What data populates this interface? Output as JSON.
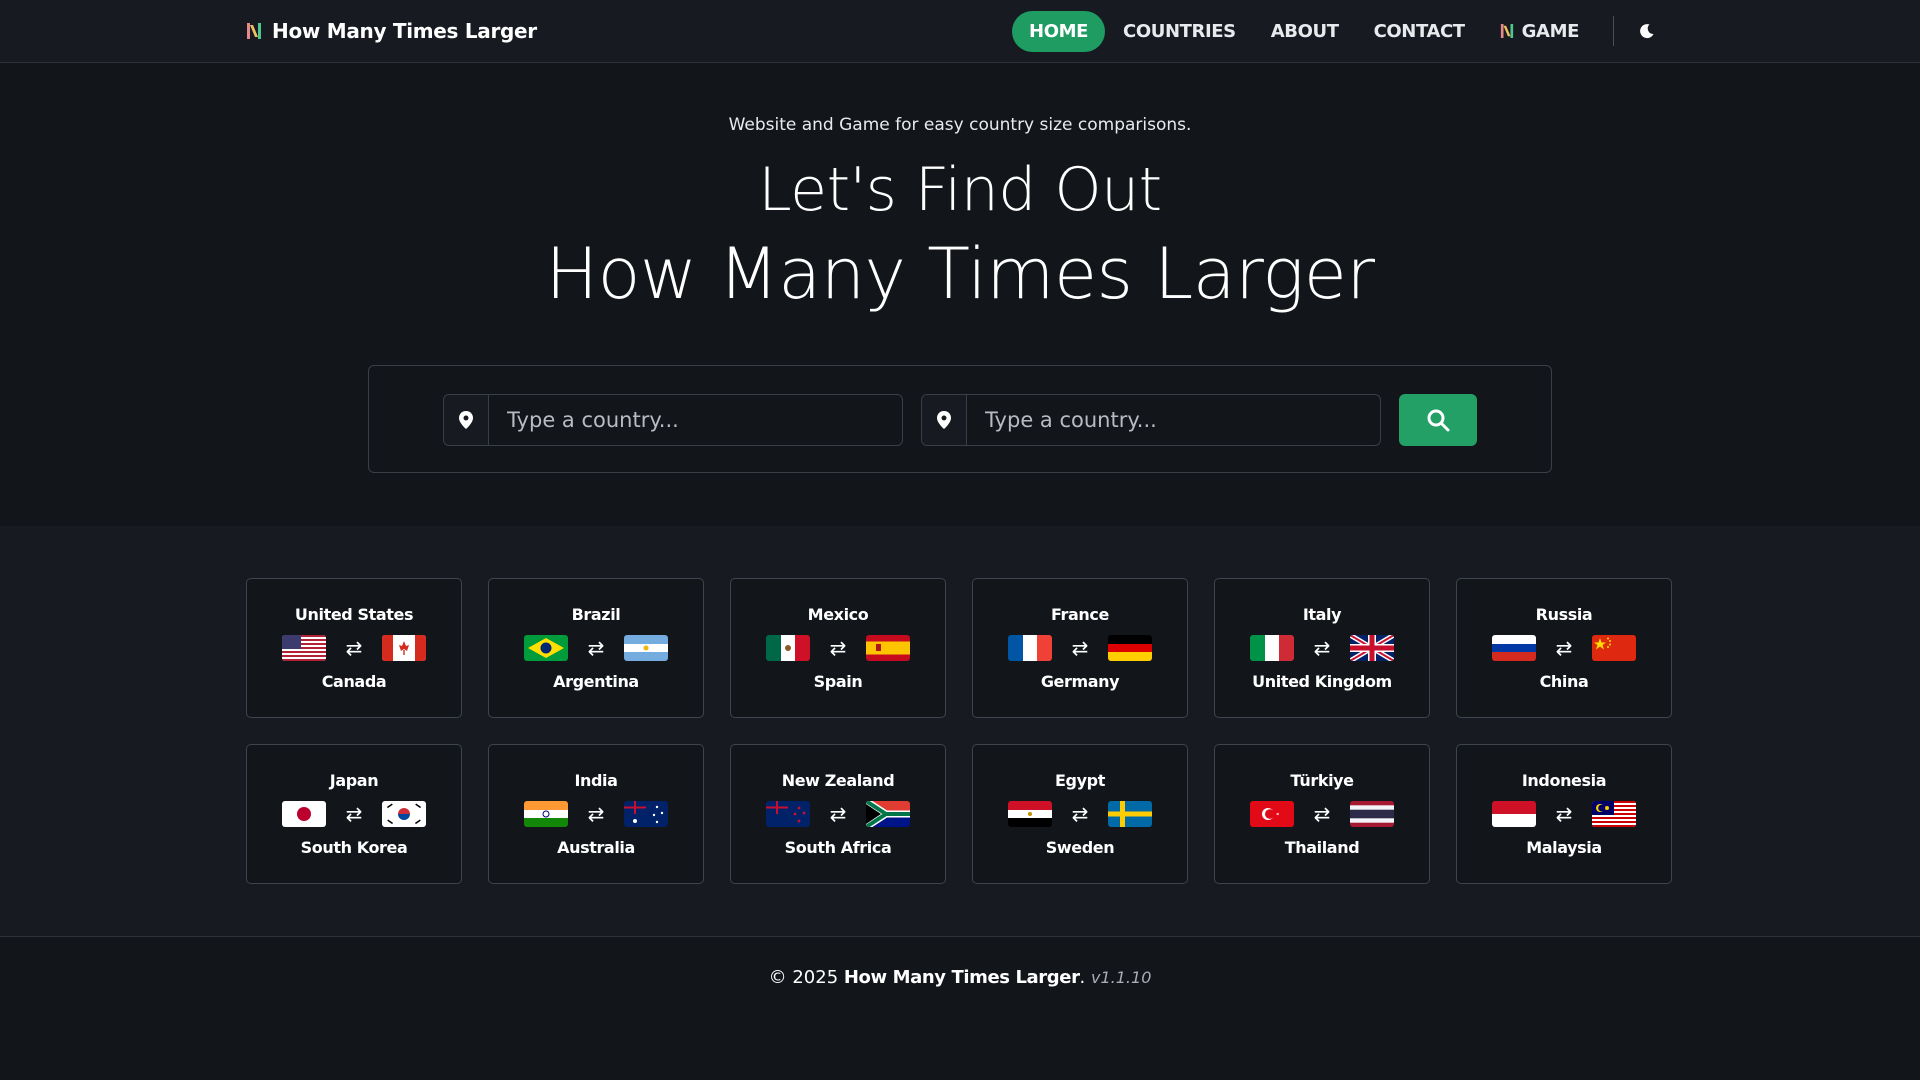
{
  "nav": {
    "brand": "How Many Times Larger",
    "items": {
      "home": "HOME",
      "countries": "COUNTRIES",
      "about": "ABOUT",
      "contact": "CONTACT",
      "game": "GAME"
    },
    "theme_icon": "moon-icon"
  },
  "hero": {
    "tagline": "Website and Game for easy country size comparisons.",
    "line1": "Let's Find Out",
    "line2": "How Many Times Larger",
    "placeholder1": "Type a country...",
    "placeholder2": "Type a country...",
    "search_icon": "search-icon",
    "pin_icon": "map-pin-icon"
  },
  "comparisons": [
    {
      "a": "United States",
      "b": "Canada"
    },
    {
      "a": "Brazil",
      "b": "Argentina"
    },
    {
      "a": "Mexico",
      "b": "Spain"
    },
    {
      "a": "France",
      "b": "Germany"
    },
    {
      "a": "Italy",
      "b": "United Kingdom"
    },
    {
      "a": "Russia",
      "b": "China"
    },
    {
      "a": "Japan",
      "b": "South Korea"
    },
    {
      "a": "India",
      "b": "Australia"
    },
    {
      "a": "New Zealand",
      "b": "South Africa"
    },
    {
      "a": "Egypt",
      "b": "Sweden"
    },
    {
      "a": "Türkiye",
      "b": "Thailand"
    },
    {
      "a": "Indonesia",
      "b": "Malaysia"
    }
  ],
  "swap_symbol": "⇄",
  "footer": {
    "copyright": "© 2025",
    "brand": "How Many Times Larger",
    "dot": ".",
    "version": "v1.1.10"
  },
  "colors": {
    "accent": "#1e9c62",
    "background": "#12161b",
    "surface": "#171b21"
  }
}
